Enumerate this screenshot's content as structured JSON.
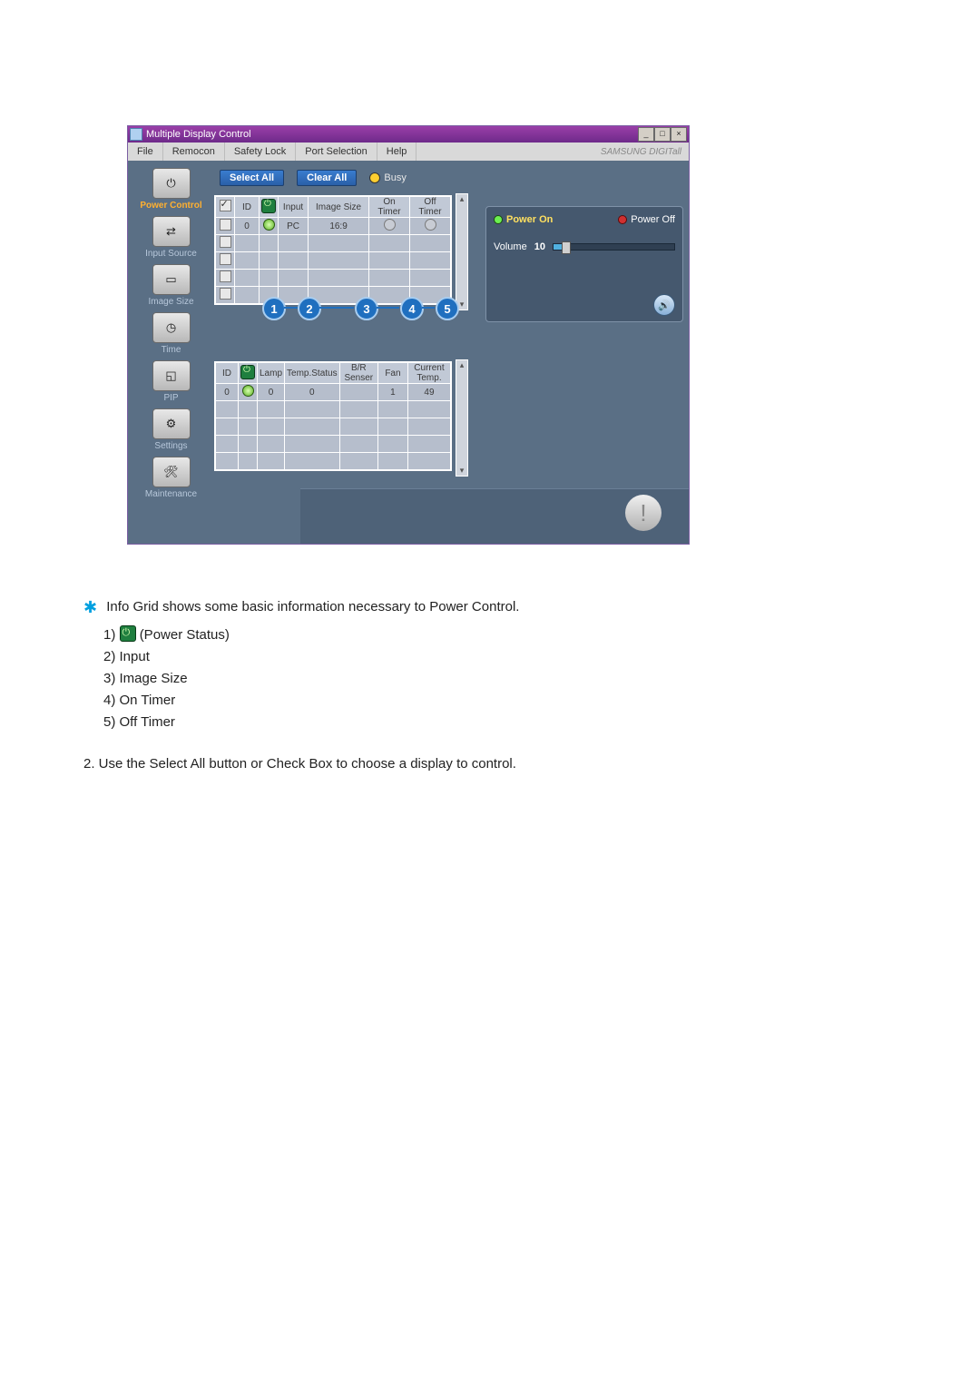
{
  "window": {
    "title": "Multiple Display Control",
    "brand": "SAMSUNG DIGITall"
  },
  "menus": [
    "File",
    "Remocon",
    "Safety Lock",
    "Port Selection",
    "Help"
  ],
  "sidebar": [
    {
      "label": "Power Control",
      "active": true
    },
    {
      "label": "Input Source",
      "active": false
    },
    {
      "label": "Image Size",
      "active": false
    },
    {
      "label": "Time",
      "active": false
    },
    {
      "label": "PIP",
      "active": false
    },
    {
      "label": "Settings",
      "active": false
    },
    {
      "label": "Maintenance",
      "active": false
    }
  ],
  "toolbar": {
    "select_all": "Select All",
    "clear_all": "Clear All",
    "busy": "Busy"
  },
  "grid1": {
    "headers": [
      "",
      "ID",
      "",
      "Input",
      "Image Size",
      "On Timer",
      "Off Timer"
    ],
    "rows": [
      {
        "checked": true,
        "id": "0",
        "status": "green",
        "input": "PC",
        "image_size": "16:9",
        "on_timer": "○",
        "off_timer": "○"
      },
      {
        "checked": false
      },
      {
        "checked": false
      },
      {
        "checked": false
      },
      {
        "checked": false
      }
    ]
  },
  "grid2": {
    "headers": [
      "ID",
      "",
      "Lamp",
      "Temp.Status",
      "B/R Senser",
      "Fan",
      "Current Temp."
    ],
    "rows": [
      {
        "id": "0",
        "status": "green",
        "lamp": "0",
        "temp_status": "0",
        "br": "",
        "fan": "1",
        "cur_temp": "49"
      },
      {},
      {},
      {},
      {}
    ]
  },
  "badges": [
    "1",
    "2",
    "3",
    "4",
    "5"
  ],
  "panel": {
    "power_on": "Power On",
    "power_off": "Power Off",
    "volume_label": "Volume",
    "volume_value": "10",
    "volume_pct": 10
  },
  "doc": {
    "intro": "Info Grid shows some basic information necessary to Power Control.",
    "items": [
      "(Power Status)",
      "Input",
      "Image Size",
      "On Timer",
      "Off Timer"
    ],
    "note": "2.  Use the Select All button or Check Box to choose a display to control."
  }
}
